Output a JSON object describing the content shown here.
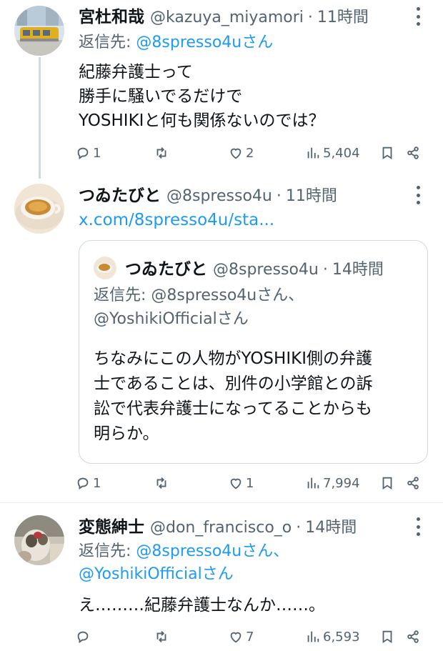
{
  "tweets": [
    {
      "name": "宮杜和哉",
      "handle": "@kazuya_miyamori",
      "dot": "·",
      "time": "11時間",
      "reply_prefix": "返信先: ",
      "reply_mentions": "@8spresso4uさん",
      "text_lines": [
        "紀藤弁護士って",
        "勝手に騒いでるだけで",
        "YOSHIKIと何も関係ないのでは？"
      ],
      "stats": {
        "replies": "1",
        "retweets": "",
        "likes": "2",
        "views": "5,404"
      }
    },
    {
      "name": "つゐたびと",
      "handle": "@8spresso4u",
      "dot": "·",
      "time": "11時間",
      "link": "x.com/8spresso4u/sta...",
      "quote": {
        "name": "つゐたびと",
        "handle": "@8spresso4u",
        "dot": "·",
        "time": "14時間",
        "reply_prefix": "返信先: ",
        "reply_line1": "@8spresso4uさん、",
        "reply_line2": "@YoshikiOfficialさん",
        "text_lines": [
          "ちなみにこの人物がYOSHIKI側の弁護",
          "士であることは、別件の小学館との訴",
          "訟で代表弁護士になってることからも",
          "明らか。"
        ]
      },
      "stats": {
        "replies": "1",
        "retweets": "",
        "likes": "1",
        "views": "7,994"
      }
    },
    {
      "name": "変態紳士",
      "handle": "@don_francisco_o",
      "dot": "·",
      "time": "14時間",
      "reply_prefix": "返信先: ",
      "reply_line1": "@8spresso4uさん、",
      "reply_line2": "@YoshikiOfficialさん",
      "text_lines": [
        "え………紀藤弁護士なんか……。"
      ],
      "stats": {
        "replies": "",
        "retweets": "",
        "likes": "7",
        "views": "6,593"
      }
    }
  ],
  "icons": {
    "reply": "reply-icon",
    "retweet": "retweet-icon",
    "like": "heart-icon",
    "views": "views-icon",
    "bookmark": "bookmark-icon",
    "share": "share-icon",
    "more": "more-dots-icon"
  },
  "colors": {
    "accent": "#1d9bf0",
    "secondary": "#536471",
    "text": "#0f1419",
    "border": "#cfd9de"
  }
}
